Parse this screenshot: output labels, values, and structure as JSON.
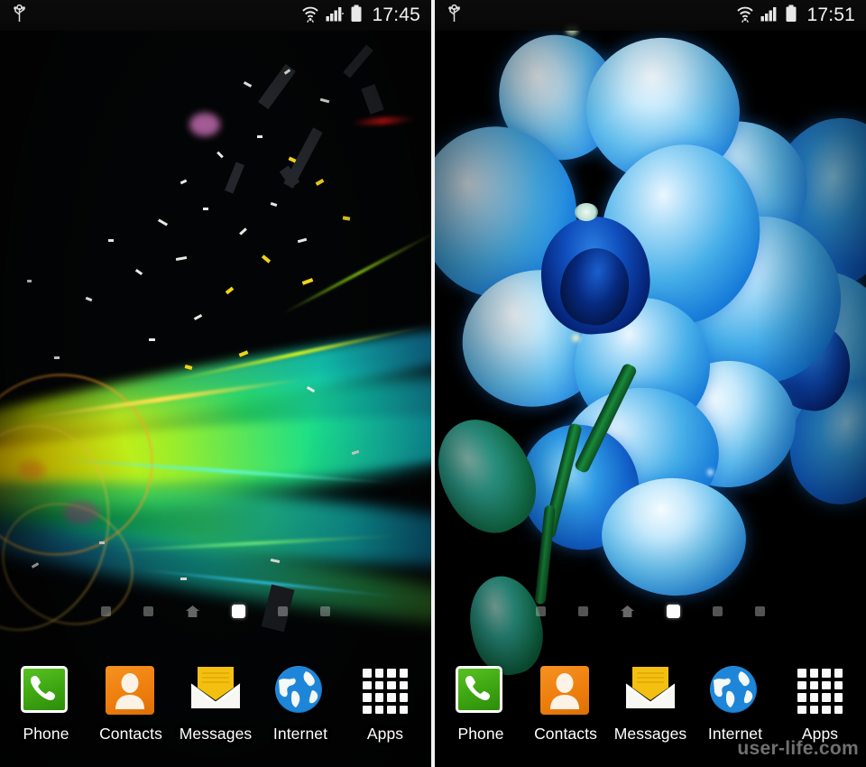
{
  "screens": [
    {
      "id": "left",
      "wallpaper_name": "abstract-neon-light-trails",
      "wallpaper_description": "Abstract neon light streaks in cyan, green, yellow and orange over a black starfield with white and yellow debris particles",
      "status_bar": {
        "usb_icon": "usb-icon",
        "wifi_icon": "wifi-icon",
        "signal_icon": "signal-bars-icon",
        "battery_icon": "battery-icon",
        "clock": "17:45"
      },
      "page_indicator": {
        "count": 6,
        "active_index": 3,
        "home_index": 2
      },
      "dock": [
        {
          "label": "Phone",
          "icon": "phone-icon"
        },
        {
          "label": "Contacts",
          "icon": "contacts-icon"
        },
        {
          "label": "Messages",
          "icon": "messages-envelope-icon"
        },
        {
          "label": "Internet",
          "icon": "internet-globe-icon"
        },
        {
          "label": "Apps",
          "icon": "apps-grid-icon"
        }
      ],
      "watermark": ""
    },
    {
      "id": "right",
      "wallpaper_name": "blue-orchid",
      "wallpaper_description": "Close-up photo of blue phalaenopsis orchid blooms with white-tipped petals, deep blue centre and green stem on black background",
      "status_bar": {
        "usb_icon": "usb-icon",
        "wifi_icon": "wifi-icon",
        "signal_icon": "signal-bars-icon",
        "battery_icon": "battery-icon",
        "clock": "17:51"
      },
      "page_indicator": {
        "count": 6,
        "active_index": 3,
        "home_index": 2
      },
      "dock": [
        {
          "label": "Phone",
          "icon": "phone-icon"
        },
        {
          "label": "Contacts",
          "icon": "contacts-icon"
        },
        {
          "label": "Messages",
          "icon": "messages-envelope-icon"
        },
        {
          "label": "Internet",
          "icon": "internet-globe-icon"
        },
        {
          "label": "Apps",
          "icon": "apps-grid-icon"
        }
      ],
      "watermark": "user-life.com"
    }
  ],
  "colors": {
    "status_text": "#f2f2f2",
    "dock_label": "#ffffff",
    "indicator_active": "#fdfdfd",
    "indicator_inactive": "#808080",
    "phone_green": "#3da511",
    "contacts_orange": "#ee7d0d",
    "message_yellow": "#f5c518",
    "internet_blue": "#1b7fd0",
    "divider": "#f2f2f2",
    "watermark": "#969696"
  }
}
